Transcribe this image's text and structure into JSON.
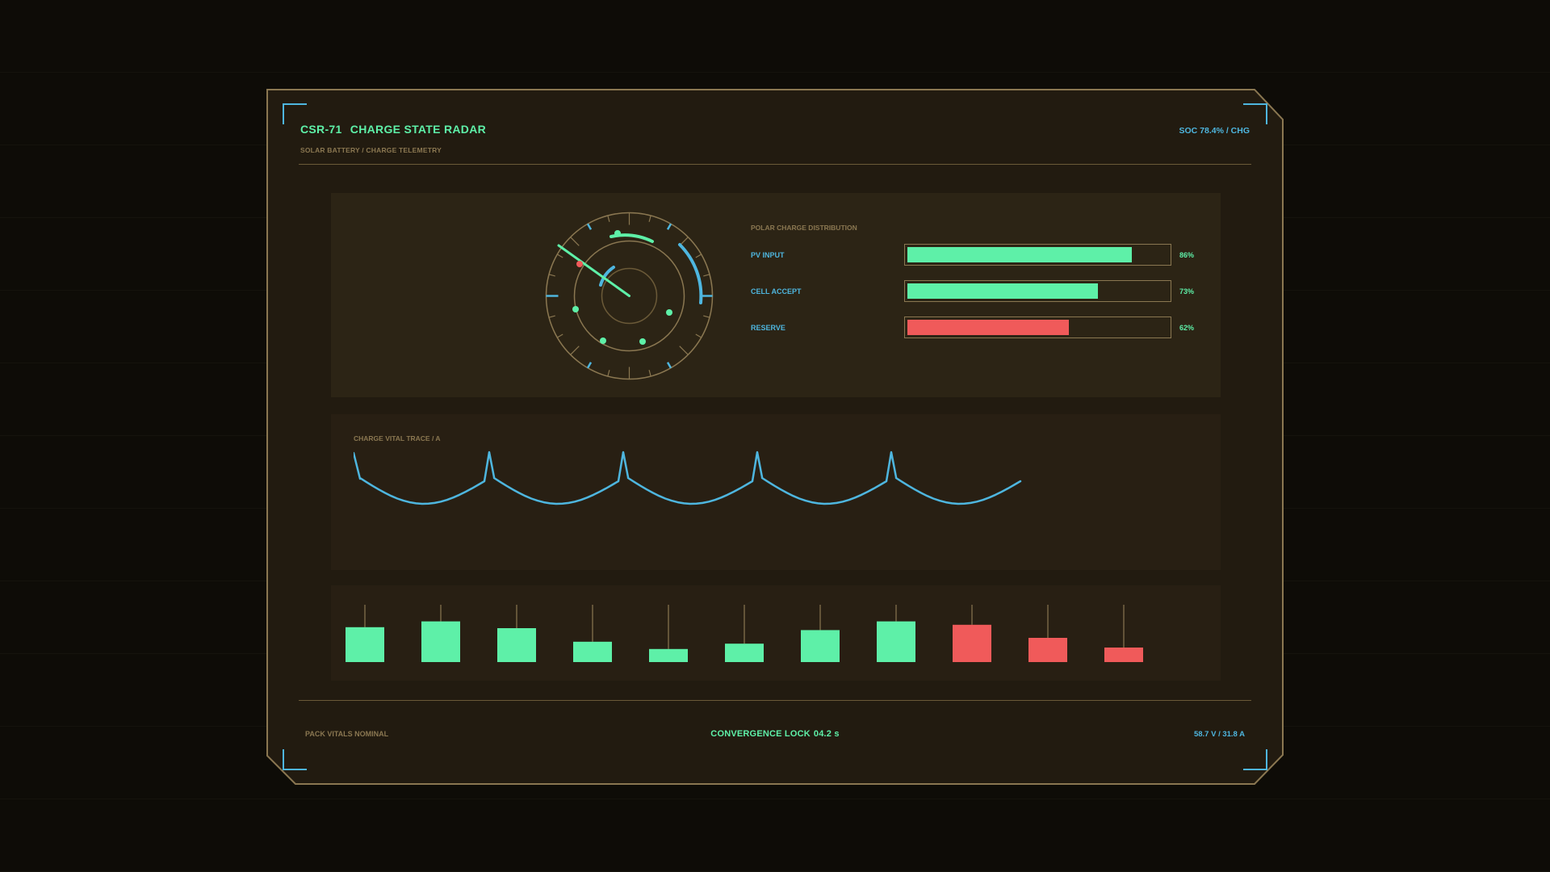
{
  "header": {
    "code": "CSR-71",
    "title": "CHARGE STATE RADAR",
    "subtitle": "SOLAR BATTERY / CHARGE TELEMETRY",
    "status": "SOC 78.4% / CHG"
  },
  "radar": {
    "icon": "radar-gauge-icon"
  },
  "distribution": {
    "title": "POLAR CHARGE DISTRIBUTION",
    "rows": [
      {
        "label": "PV INPUT",
        "value": 86,
        "value_label": "86%",
        "color": "#5ef0a8"
      },
      {
        "label": "CELL ACCEPT",
        "value": 73,
        "value_label": "73%",
        "color": "#5ef0a8"
      },
      {
        "label": "RESERVE",
        "value": 62,
        "value_label": "62%",
        "color": "#f05a5a"
      }
    ]
  },
  "trace": {
    "title": "CHARGE VITAL TRACE / A"
  },
  "bars": {
    "values": [
      0.72,
      0.84,
      0.7,
      0.42,
      0.27,
      0.38,
      0.66,
      0.84,
      0.77,
      0.5,
      0.3
    ],
    "colors": [
      "#5ef0a8",
      "#5ef0a8",
      "#5ef0a8",
      "#5ef0a8",
      "#5ef0a8",
      "#5ef0a8",
      "#5ef0a8",
      "#5ef0a8",
      "#f05a5a",
      "#f05a5a",
      "#f05a5a"
    ]
  },
  "footer": {
    "left": "PACK VITALS NOMINAL",
    "center_label": "CONVERGENCE LOCK",
    "center_value": "04.2 s",
    "right": "58.7 V  /  31.8 A"
  },
  "colors": {
    "accent_green": "#5ef0a8",
    "accent_blue": "#4eb6df",
    "alert_red": "#f05a5a",
    "frame": "#8a7751"
  }
}
